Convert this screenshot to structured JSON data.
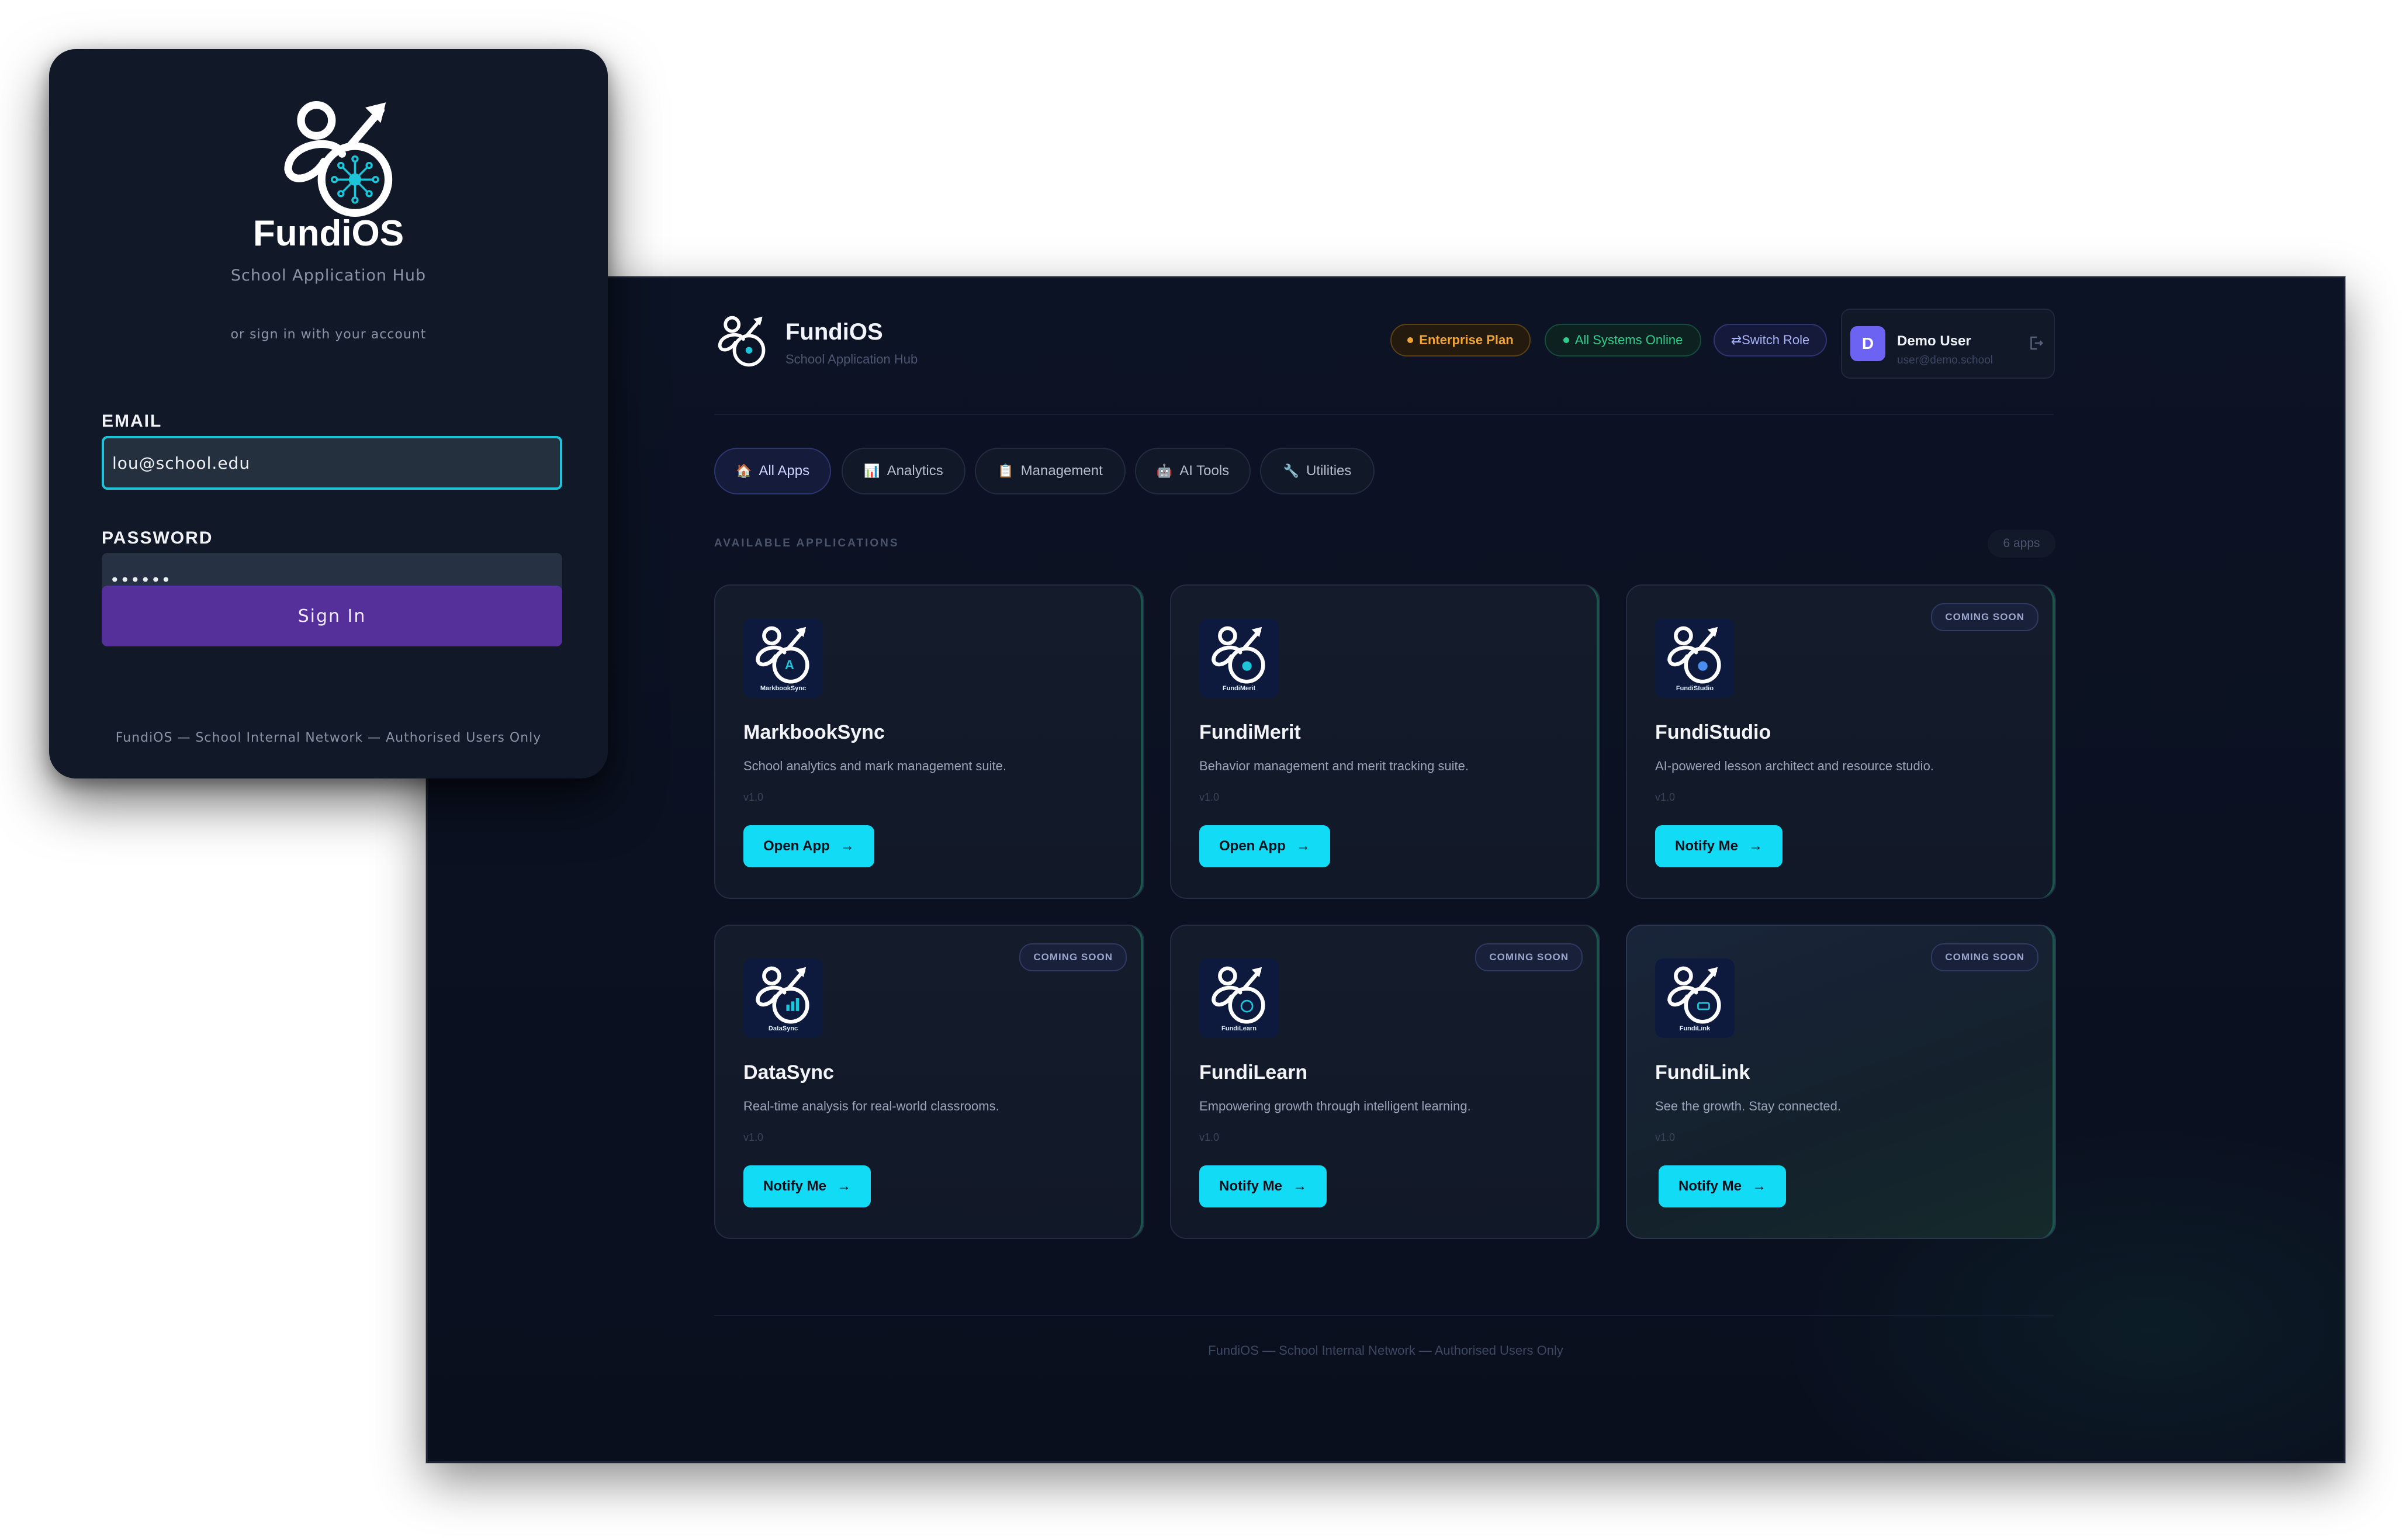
{
  "colors": {
    "accent_cyan": "#12dcf5",
    "signin_purple": "#55309a",
    "enterprise_amber": "#f0a436",
    "online_green": "#2fcf8b",
    "avatar_violet": "#6c63f2"
  },
  "dashboard": {
    "brand": "FundiOS",
    "subtitle": "School Application Hub",
    "header": {
      "plan": "Enterprise Plan",
      "status": "All Systems Online",
      "switch_role": "⇄Switch Role"
    },
    "user": {
      "initial": "D",
      "name": "Demo User",
      "email": "user@demo.school",
      "logout_icon": "logout-icon"
    },
    "tabs": [
      {
        "icon": "🏠",
        "label": "All Apps"
      },
      {
        "icon": "📊",
        "label": "Analytics"
      },
      {
        "icon": "📋",
        "label": "Management"
      },
      {
        "icon": "🤖",
        "label": "AI Tools"
      },
      {
        "icon": "🔧",
        "label": "Utilities"
      }
    ],
    "section_title": "AVAILABLE APPLICATIONS",
    "apps_count": "6 apps",
    "badge_text": "COMING SOON",
    "apps": [
      {
        "name": "MarkbookSync",
        "logo_label": "MarkbookSync",
        "description": "School analytics and mark management suite.",
        "version": "v1.0",
        "button": "Open App"
      },
      {
        "name": "FundiMerit",
        "logo_label": "FundiMerit",
        "description": "Behavior management and merit tracking suite.",
        "version": "v1.0",
        "button": "Open App"
      },
      {
        "name": "FundiStudio",
        "logo_label": "FundiStudio",
        "description": "AI-powered lesson architect and resource studio.",
        "version": "v1.0",
        "button": "Notify Me"
      },
      {
        "name": "DataSync",
        "logo_label": "DataSync",
        "description": "Real-time analysis for real-world classrooms.",
        "version": "v1.0",
        "button": "Notify Me"
      },
      {
        "name": "FundiLearn",
        "logo_label": "FundiLearn",
        "description": "Empowering growth through intelligent learning.",
        "version": "v1.0",
        "button": "Notify Me"
      },
      {
        "name": "FundiLink",
        "logo_label": "FundiLink",
        "description": "See the growth. Stay connected.",
        "version": "v1.0",
        "button": "Notify Me"
      }
    ],
    "footer": "FundiOS — School Internal Network — Authorised Users Only"
  },
  "login": {
    "brand": "FundiOS",
    "subtitle": "School Application Hub",
    "or_text": "or sign in with your account",
    "email_label": "EMAIL",
    "email_value": "lou@school.edu",
    "password_label": "PASSWORD",
    "password_value": "••••••",
    "signin_button": "Sign In",
    "footer": "FundiOS — School Internal Network — Authorised Users Only"
  }
}
